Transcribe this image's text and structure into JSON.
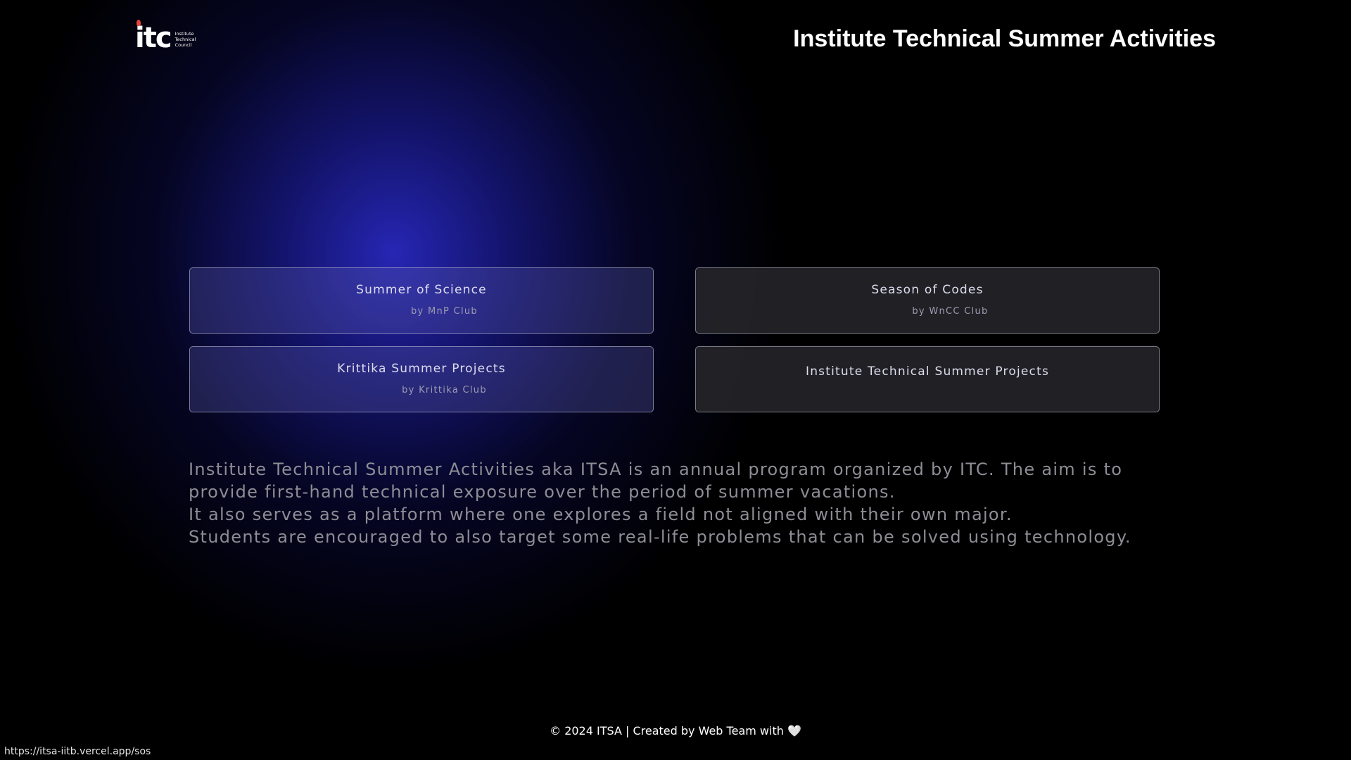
{
  "header": {
    "logo_text": "itc",
    "logo_subtext": [
      "Institute",
      "Technical",
      "Council"
    ],
    "title": "Institute Technical Summer Activities"
  },
  "cards": [
    {
      "title": "Summer of Science",
      "subtitle": "by MnP Club"
    },
    {
      "title": "Season of Codes",
      "subtitle": "by WnCC Club"
    },
    {
      "title": "Krittika Summer Projects",
      "subtitle": "by Krittika Club"
    },
    {
      "title": "Institute Technical Summer Projects",
      "subtitle": ""
    }
  ],
  "description": [
    "Institute Technical Summer Activities aka ITSA is an annual program organized by ITC. The aim is to",
    "provide first-hand technical exposure over the period of summer vacations.",
    "It also serves as a platform where one explores a field not aligned with their own major.",
    "Students are encouraged to also target some real-life problems that can be solved using technology."
  ],
  "footer": {
    "text": "© 2024 ITSA | Created by Web Team with",
    "heart": "🤍"
  },
  "status_bar": {
    "url": "https://itsa-iitb.vercel.app/sos"
  },
  "colors": {
    "background": "#000000",
    "glow": "#2828be",
    "card_border": "#c8c8dc"
  }
}
